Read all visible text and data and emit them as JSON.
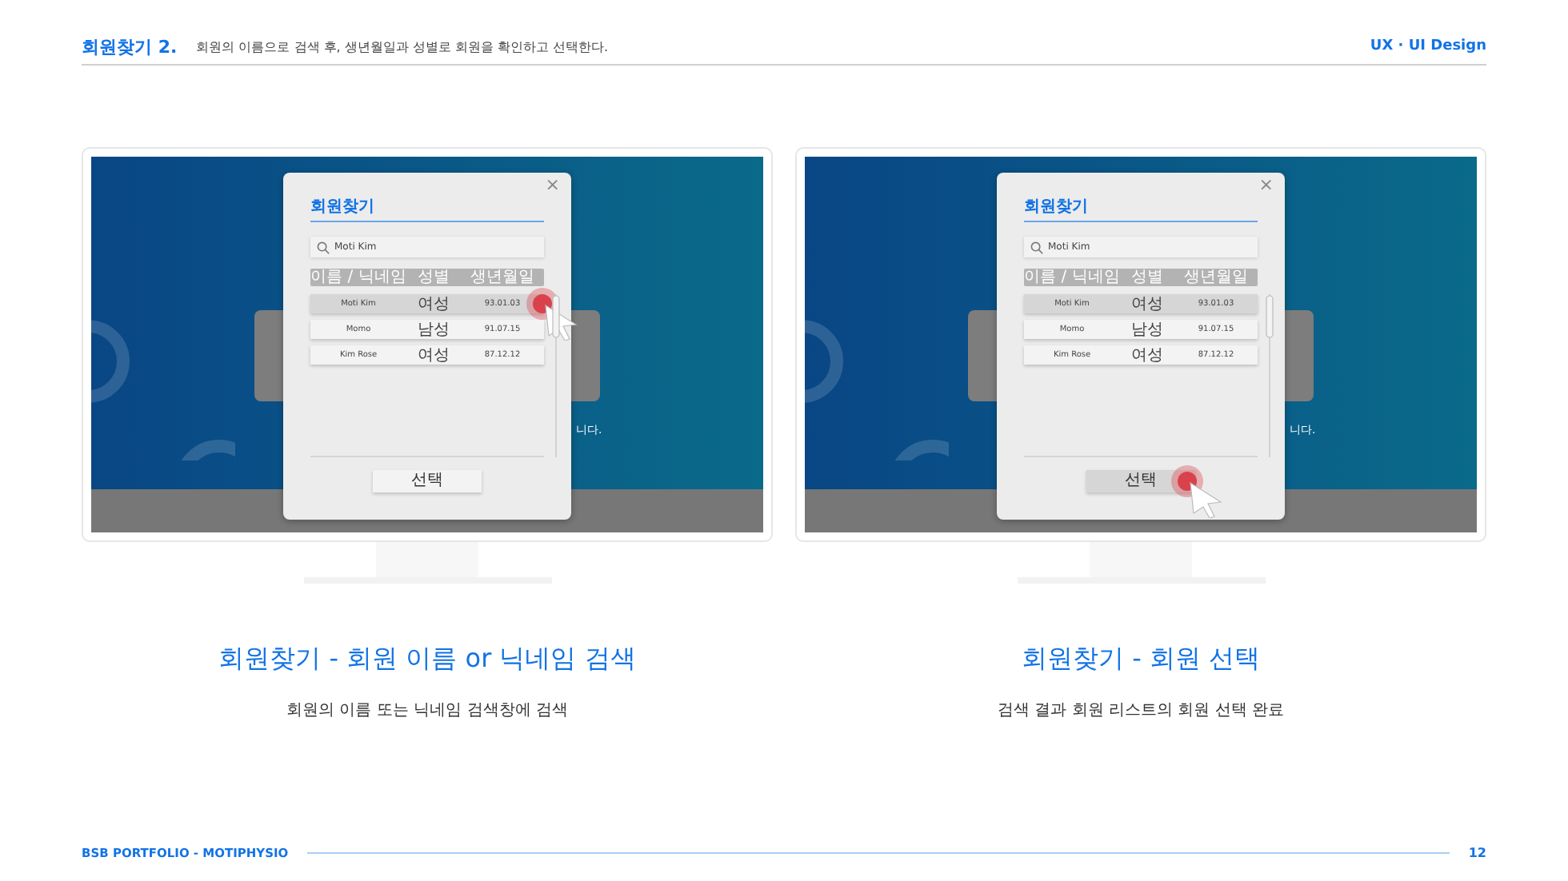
{
  "header": {
    "title": "회원찾기 2.",
    "description": "회원의 이름으로 검색 후, 생년월일과 성별로 회원을 확인하고 선택한다.",
    "tag": "UX · UI Design"
  },
  "panels": [
    {
      "screen": {
        "background_text": "니다.",
        "modal": {
          "title": "회원찾기",
          "close": "×",
          "search": "Moti Kim",
          "columns": [
            "이름 / 닉네임",
            "성별",
            "생년월일"
          ],
          "rows": [
            {
              "name": "Moti Kim",
              "gender": "여성",
              "birth": "93.01.03",
              "selected": true,
              "clicked": true
            },
            {
              "name": "Momo",
              "gender": "남성",
              "birth": "91.07.15",
              "selected": false,
              "clicked": false
            },
            {
              "name": "Kim Rose",
              "gender": "여성",
              "birth": "87.12.12",
              "selected": false,
              "clicked": false
            }
          ],
          "button": {
            "label": "선택",
            "clicked": false
          }
        }
      },
      "caption": "회원찾기 - 회원 이름 or 닉네임 검색",
      "subcaption": "회원의 이름 또는 닉네임 검색창에 검색"
    },
    {
      "screen": {
        "background_text": "니다.",
        "modal": {
          "title": "회원찾기",
          "close": "×",
          "search": "Moti Kim",
          "columns": [
            "이름 / 닉네임",
            "성별",
            "생년월일"
          ],
          "rows": [
            {
              "name": "Moti Kim",
              "gender": "여성",
              "birth": "93.01.03",
              "selected": true,
              "clicked": false
            },
            {
              "name": "Momo",
              "gender": "남성",
              "birth": "91.07.15",
              "selected": false,
              "clicked": false
            },
            {
              "name": "Kim Rose",
              "gender": "여성",
              "birth": "87.12.12",
              "selected": false,
              "clicked": false
            }
          ],
          "button": {
            "label": "선택",
            "clicked": true
          }
        }
      },
      "caption": "회원찾기 - 회원 선택",
      "subcaption": "검색 결과 회원 리스트의 회원 선택 완료"
    }
  ],
  "footer": {
    "label": "BSB PORTFOLIO - MOTIPHYSIO",
    "page": "12"
  }
}
